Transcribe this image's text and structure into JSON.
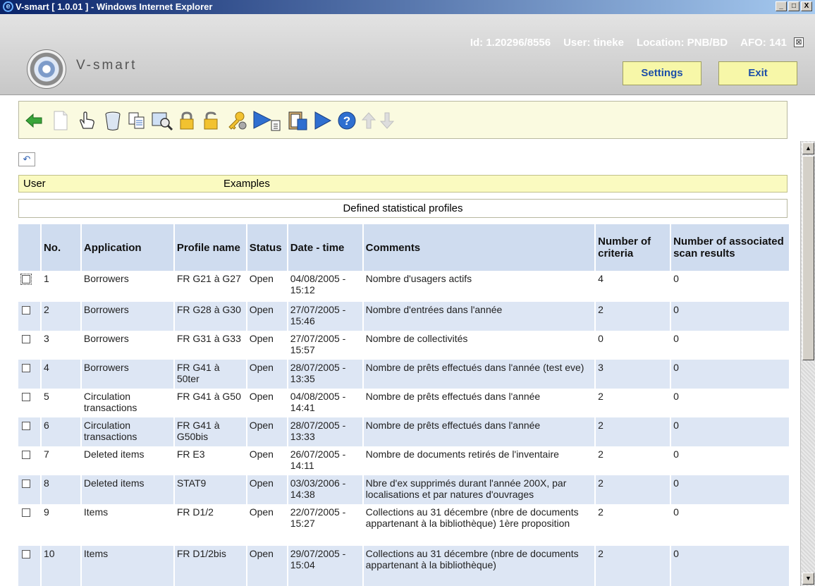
{
  "window": {
    "title": "V-smart [ 1.0.01 ] - Windows Internet Explorer",
    "minimize": "_",
    "maximize": "□",
    "close": "X"
  },
  "header": {
    "brand": "V-smart",
    "id_label": "Id: 1.20296/8556",
    "user_label": "User: tineke",
    "location_label": "Location: PNB/BD",
    "afo_label": "AFO: 141",
    "settings_label": "Settings",
    "exit_label": "Exit",
    "close_glyph": "⊠"
  },
  "toolbar": {
    "icons": [
      "back-arrow-icon",
      "new-page-icon",
      "hand-select-icon",
      "trash-bin-icon",
      "copy-icon",
      "search-record-icon",
      "lock-icon",
      "unlock-icon",
      "key-settings-icon",
      "run-to-list-icon",
      "clipboard-icon",
      "play-icon",
      "help-icon",
      "up-arrow-icon",
      "down-arrow-icon"
    ]
  },
  "main": {
    "undo_glyph": "↶",
    "band": {
      "left": "User",
      "right": "Examples"
    },
    "caption": "Defined statistical profiles",
    "columns": [
      "No.",
      "Application",
      "Profile name",
      "Status",
      "Date - time",
      "Comments",
      "Number of criteria",
      "Number of associated scan results"
    ],
    "rows": [
      {
        "no": "1",
        "application": "Borrowers",
        "profile": "FR G21 à G27",
        "status": "Open",
        "datetime": "04/08/2005 - 15:12",
        "comments": "Nombre d'usagers actifs",
        "criteria": "4",
        "scan": "0"
      },
      {
        "no": "2",
        "application": "Borrowers",
        "profile": "FR G28 à G30",
        "status": "Open",
        "datetime": "27/07/2005 - 15:46",
        "comments": "Nombre d'entrées dans l'année",
        "criteria": "2",
        "scan": "0"
      },
      {
        "no": "3",
        "application": "Borrowers",
        "profile": "FR G31 à G33",
        "status": "Open",
        "datetime": "27/07/2005 - 15:57",
        "comments": "Nombre de collectivités",
        "criteria": "0",
        "scan": "0"
      },
      {
        "no": "4",
        "application": "Borrowers",
        "profile": "FR G41 à 50ter",
        "status": "Open",
        "datetime": "28/07/2005 - 13:35",
        "comments": "Nombre de prêts effectués dans l'année (test eve)",
        "criteria": "3",
        "scan": "0"
      },
      {
        "no": "5",
        "application": "Circulation transactions",
        "profile": "FR G41 à G50",
        "status": "Open",
        "datetime": "04/08/2005 - 14:41",
        "comments": "Nombre de prêts effectués dans l'année",
        "criteria": "2",
        "scan": "0"
      },
      {
        "no": "6",
        "application": "Circulation transactions",
        "profile": "FR G41 à G50bis",
        "status": "Open",
        "datetime": "28/07/2005 - 13:33",
        "comments": "Nombre de prêts effectués dans l'année",
        "criteria": "2",
        "scan": "0"
      },
      {
        "no": "7",
        "application": "Deleted items",
        "profile": "FR E3",
        "status": "Open",
        "datetime": "26/07/2005 - 14:11",
        "comments": "Nombre de documents retirés de l'inventaire",
        "criteria": "2",
        "scan": "0"
      },
      {
        "no": "8",
        "application": "Deleted items",
        "profile": "STAT9",
        "status": "Open",
        "datetime": "03/03/2006 - 14:38",
        "comments": "Nbre d'ex supprimés durant l'année 200X, par localisations et par natures d'ouvrages",
        "criteria": "2",
        "scan": "0"
      },
      {
        "no": "9",
        "application": "Items",
        "profile": "FR D1/2",
        "status": "Open",
        "datetime": "22/07/2005 - 15:27",
        "comments": "Collections au 31 décembre (nbre de documents appartenant à la bibliothèque) 1ère proposition",
        "criteria": "2",
        "scan": "0"
      },
      {
        "no": "10",
        "application": "Items",
        "profile": "FR D1/2bis",
        "status": "Open",
        "datetime": "29/07/2005 - 15:04",
        "comments": "Collections au 31 décembre (nbre de documents appartenant à la bibliothèque)",
        "criteria": "2",
        "scan": "0"
      }
    ]
  },
  "scrollbar": {
    "up": "▲",
    "down": "▼"
  }
}
